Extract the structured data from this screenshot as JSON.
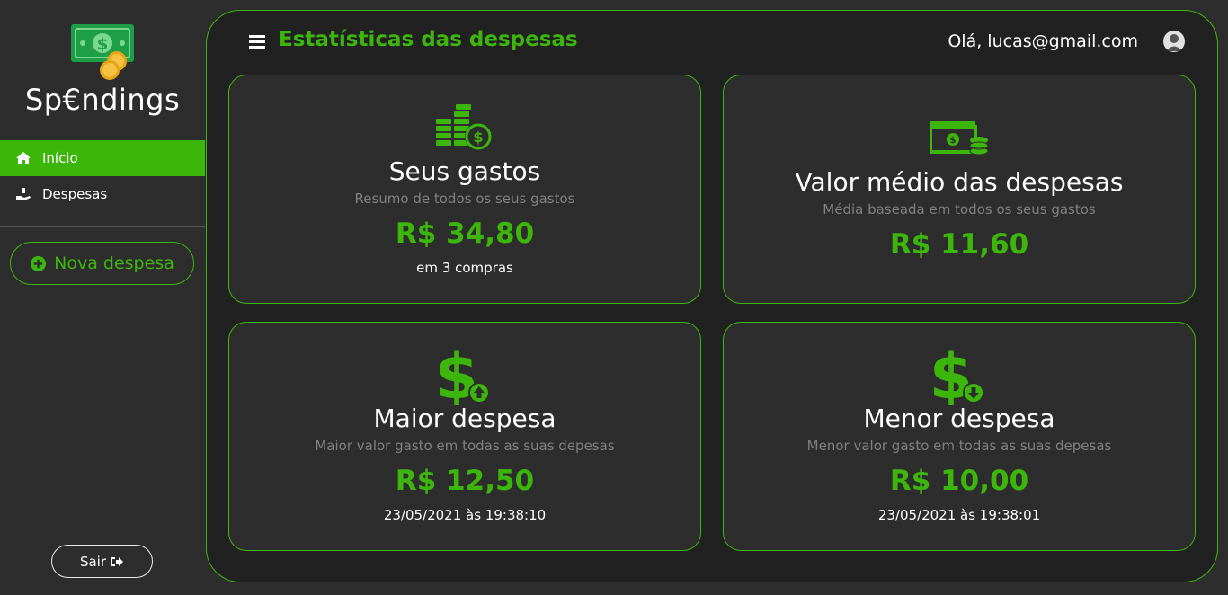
{
  "sidebar": {
    "logo_icon": "money-bill-coins-icon",
    "brand": "Sp€ndings",
    "items": [
      {
        "label": "Início",
        "icon": "home-icon",
        "active": true
      },
      {
        "label": "Despesas",
        "icon": "hand-holding-dollar-icon",
        "active": false
      }
    ],
    "new_button": {
      "label": "Nova despesa",
      "icon": "plus-circle-icon"
    },
    "logout": {
      "label": "Sair",
      "icon": "sign-out-icon"
    }
  },
  "header": {
    "menu_icon": "hamburger-icon",
    "title": "Estatísticas das despesas",
    "greeting": "Olá, lucas@gmail.com",
    "avatar_icon": "user-avatar-icon"
  },
  "cards": [
    {
      "icon": "coins-stack-icon",
      "title": "Seus gastos",
      "subtitle": "Resumo de todos os seus gastos",
      "value": "R$ 34,80",
      "note": "em 3 compras"
    },
    {
      "icon": "money-bill-coins-icon",
      "title": "Valor médio das despesas",
      "subtitle": "Média baseada em todos os seus gastos",
      "value": "R$ 11,60",
      "note": ""
    },
    {
      "icon": "dollar-arrow-up-icon",
      "title": "Maior despesa",
      "subtitle": "Maior valor gasto em todas as suas depesas",
      "value": "R$ 12,50",
      "note": "23/05/2021 às 19:38:10"
    },
    {
      "icon": "dollar-arrow-down-icon",
      "title": "Menor despesa",
      "subtitle": "Menor valor gasto em todas as suas depesas",
      "value": "R$ 10,00",
      "note": "23/05/2021 às 19:38:01"
    }
  ],
  "colors": {
    "accent": "#3db60c",
    "background": "#2d2d2d",
    "panel": "#212121",
    "muted": "#808080"
  }
}
